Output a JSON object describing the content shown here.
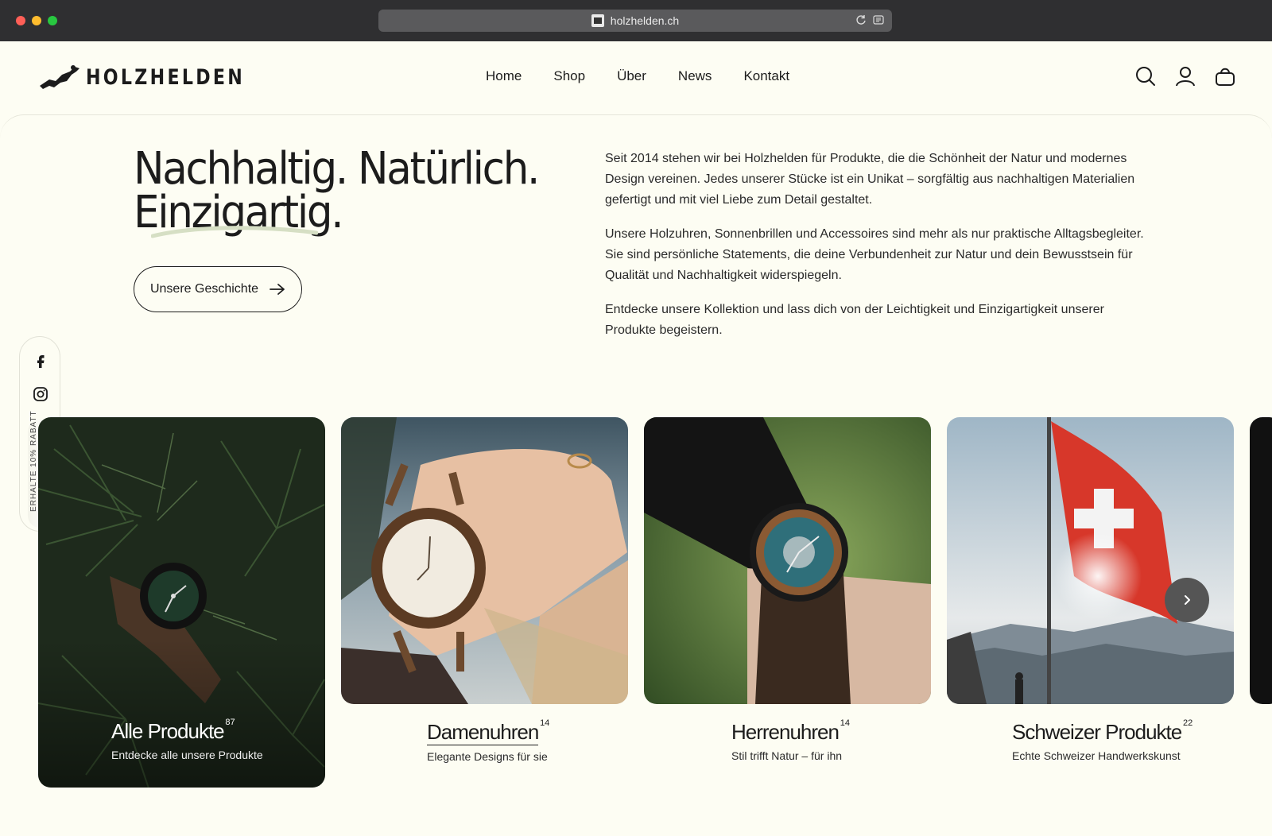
{
  "browser": {
    "url": "holzhelden.ch"
  },
  "header": {
    "logo_text": "HOLZHELDEN",
    "nav": [
      "Home",
      "Shop",
      "Über",
      "News",
      "Kontakt"
    ]
  },
  "hero": {
    "headline_line1": "Nachhaltig. Natürlich.",
    "headline_line2": "Einzigartig.",
    "cta_label": "Unsere Geschichte",
    "paragraphs": [
      "Seit 2014 stehen wir bei Holzhelden für Produkte, die die Schönheit der Natur und modernes Design vereinen. Jedes unserer Stücke ist ein Unikat – sorgfältig aus nachhaltigen Materialien gefertigt und mit viel Liebe zum Detail gestaltet.",
      "Unsere Holzuhren, Sonnenbrillen und Accessoires sind mehr als nur praktische Alltagsbegleiter. Sie sind persönliche Statements, die deine Verbundenheit zur Natur und dein Bewusstsein für Qualität und Nachhaltigkeit widerspiegeln.",
      "Entdecke unsere Kollektion und lass dich von der Leichtigkeit und Einzigartigkeit unserer Produkte begeistern."
    ]
  },
  "social": {
    "promo": "ERHALTE 10% RABATT"
  },
  "collections": [
    {
      "title": "Alle Produkte",
      "count": "87",
      "subtitle": "Entdecke alle unsere Produkte"
    },
    {
      "title": "Damenuhren",
      "count": "14",
      "subtitle": "Elegante Designs für sie"
    },
    {
      "title": "Herrenuhren",
      "count": "14",
      "subtitle": "Stil trifft Natur – für ihn"
    },
    {
      "title": "Schweizer Produkte",
      "count": "22",
      "subtitle": "Echte Schweizer Handwerkskunst"
    }
  ],
  "colors": {
    "background": "#fdfdf3",
    "text": "#1c1c1c",
    "swoosh": "#d6dfc4"
  }
}
